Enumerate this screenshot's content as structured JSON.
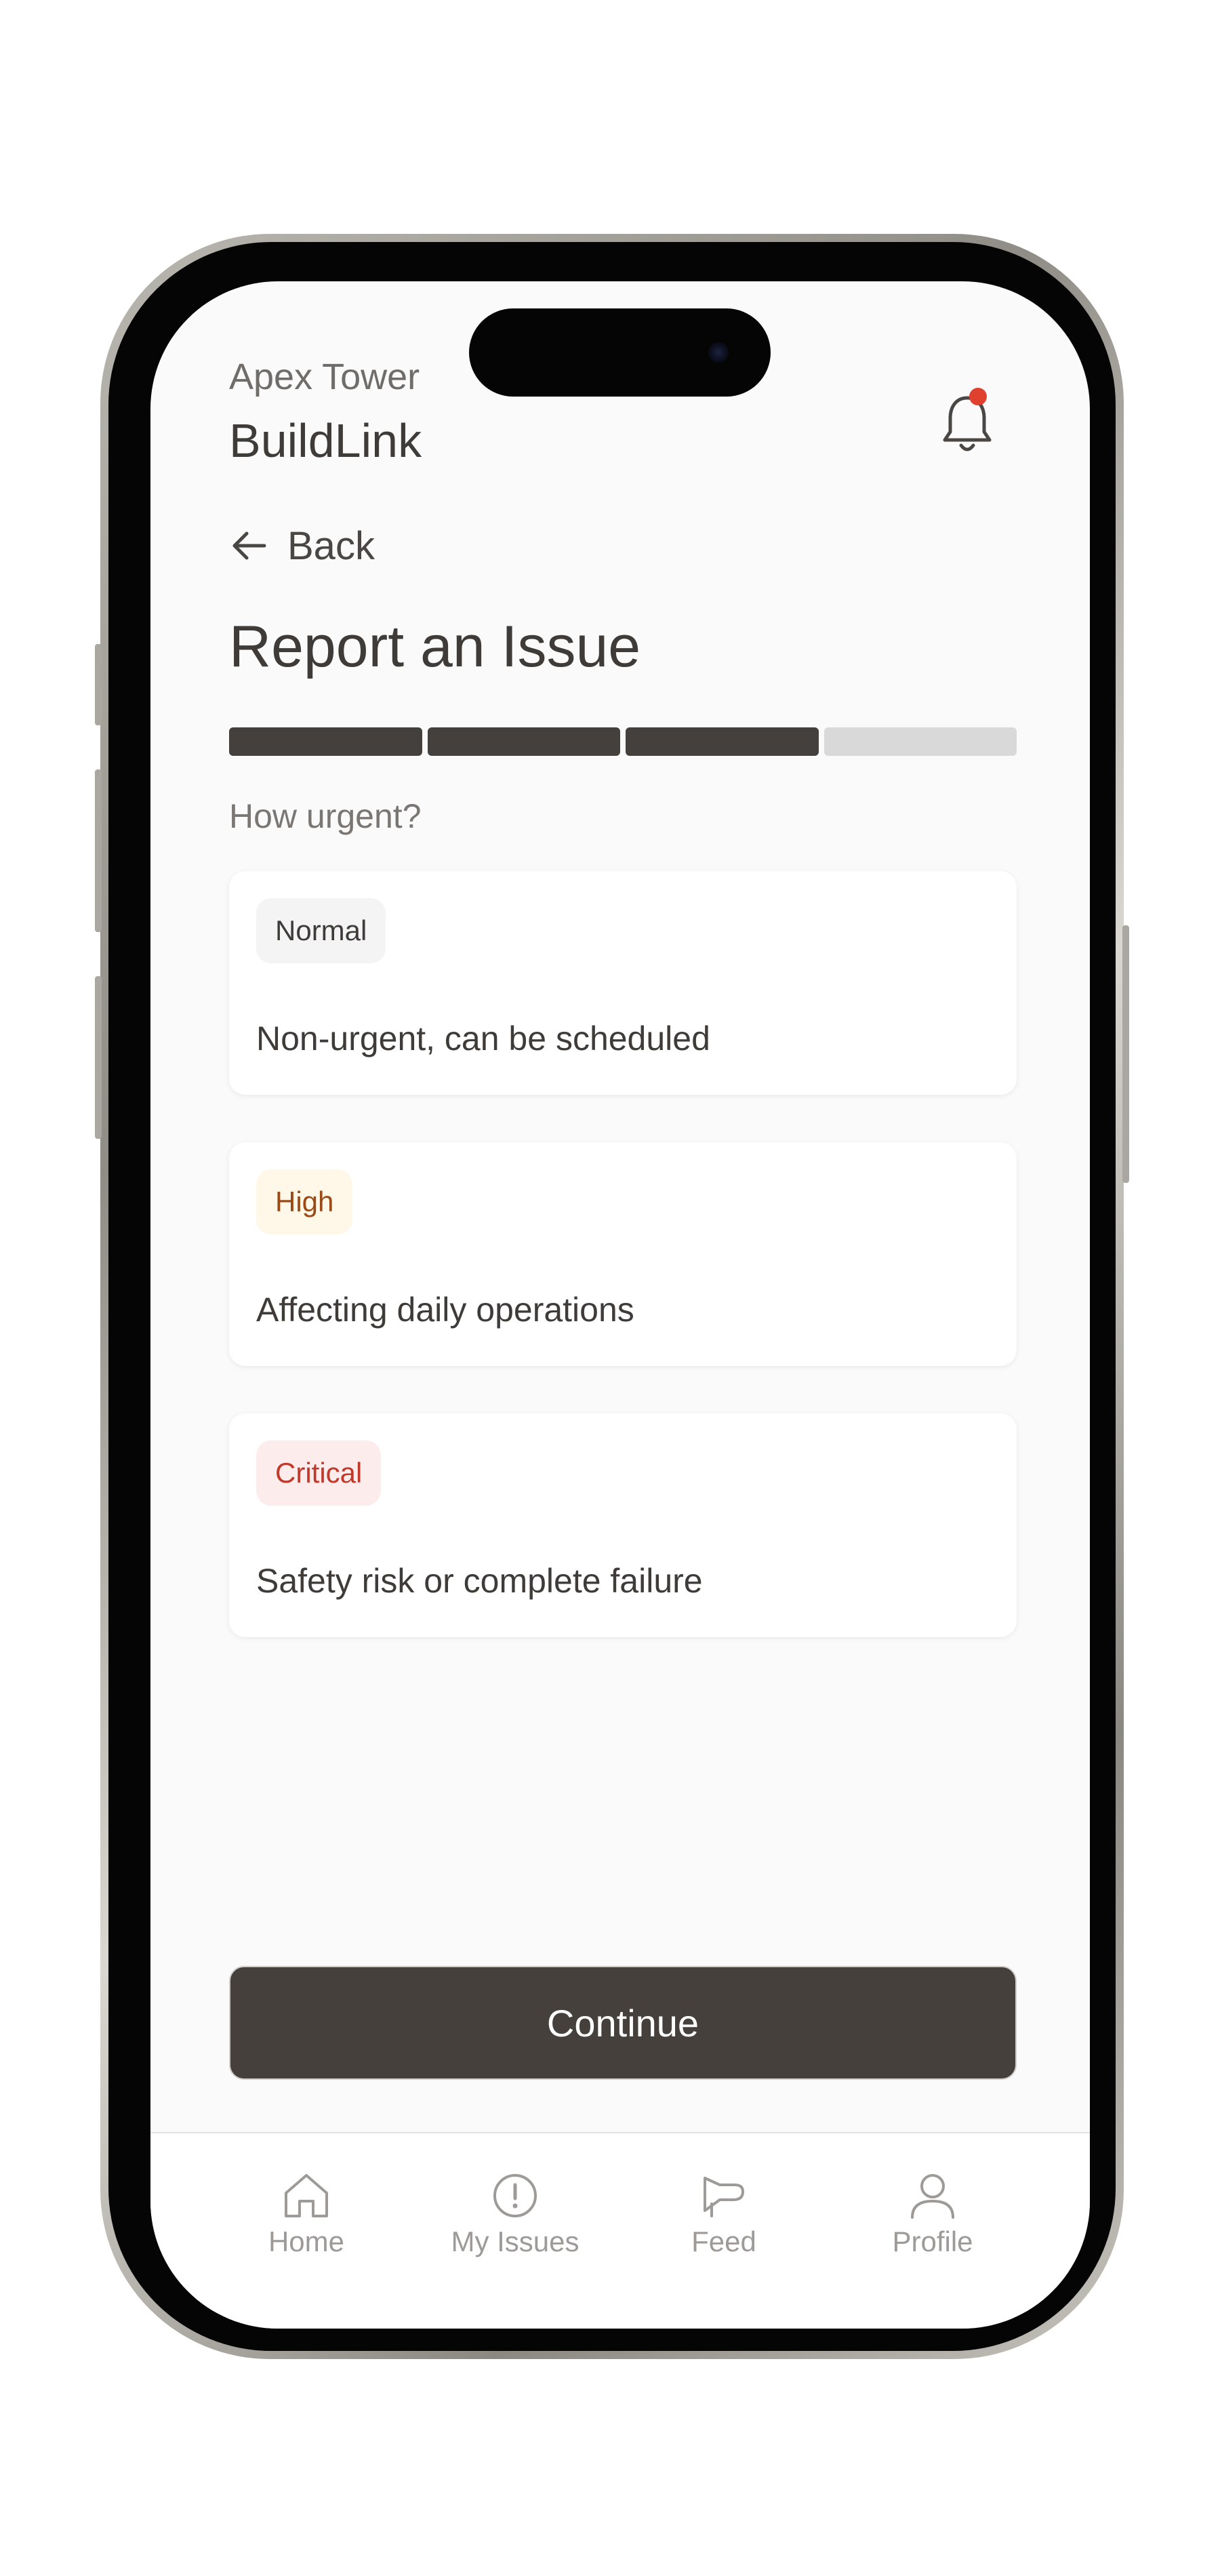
{
  "header": {
    "building": "Apex Tower",
    "app_title": "BuildLink"
  },
  "nav_back": {
    "label": "Back"
  },
  "page": {
    "title": "Report an Issue",
    "question": "How urgent?"
  },
  "progress": {
    "total_steps": 4,
    "completed_steps": 3
  },
  "options": [
    {
      "badge": "Normal",
      "description": "Non-urgent, can be scheduled",
      "badge_color": "#3f3b38",
      "badge_bg": "#f4f4f4"
    },
    {
      "badge": "High",
      "description": "Affecting daily operations",
      "badge_color": "#9a4a16",
      "badge_bg": "#fff7e8"
    },
    {
      "badge": "Critical",
      "description": "Safety risk or complete failure",
      "badge_color": "#c0392b",
      "badge_bg": "#fdecec"
    }
  ],
  "actions": {
    "continue_label": "Continue"
  },
  "tabbar": {
    "items": [
      {
        "label": "Home",
        "icon": "home-icon"
      },
      {
        "label": "My Issues",
        "icon": "alert-circle-icon"
      },
      {
        "label": "Feed",
        "icon": "megaphone-icon"
      },
      {
        "label": "Profile",
        "icon": "user-icon"
      }
    ]
  },
  "colors": {
    "primary_dark": "#45403c",
    "notification_dot": "#e0412f",
    "background": "#fafafa"
  }
}
